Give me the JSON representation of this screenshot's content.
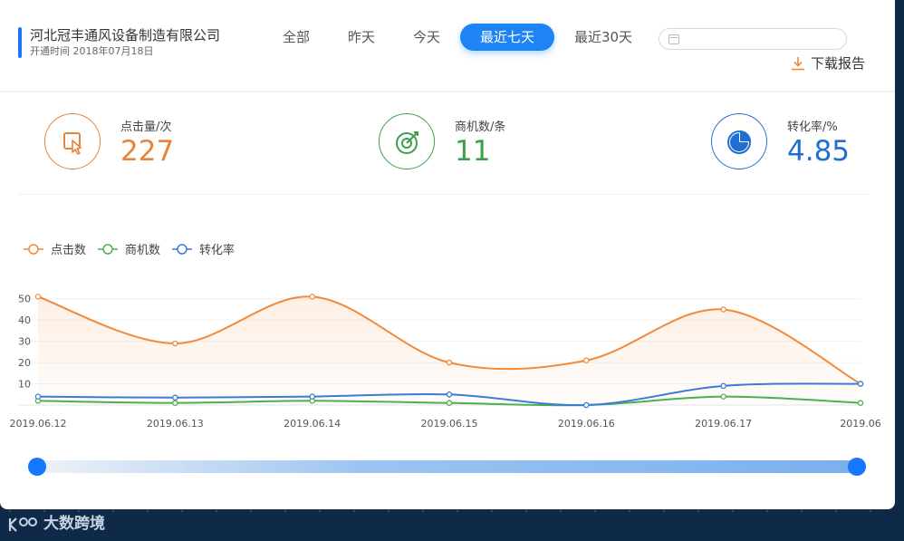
{
  "company": {
    "name": "河北冠丰通风设备制造有限公司",
    "open_date": "开通时间 2018年07月18日"
  },
  "tabs": [
    {
      "label": "全部",
      "active": false
    },
    {
      "label": "昨天",
      "active": false
    },
    {
      "label": "今天",
      "active": false
    },
    {
      "label": "最近七天",
      "active": true
    },
    {
      "label": "最近30天",
      "active": false
    }
  ],
  "date_input": {
    "value": ""
  },
  "download": {
    "label": "下载报告",
    "icon": "download-icon",
    "color": "#f08a3c"
  },
  "stats": [
    {
      "label": "点击量/次",
      "value": "227",
      "icon": "click-cursor-icon",
      "color": "#e8833a"
    },
    {
      "label": "商机数/条",
      "value": "11",
      "icon": "target-icon",
      "color": "#3aa14a"
    },
    {
      "label": "转化率/%",
      "value": "4.85",
      "icon": "pie-icon",
      "color": "#1f6fd1"
    }
  ],
  "chart_data": {
    "type": "line",
    "categories": [
      "2019.06.12",
      "2019.06.13",
      "2019.06.14",
      "2019.06.15",
      "2019.06.16",
      "2019.06.17",
      "2019.06"
    ],
    "yticks": [
      "10",
      "20",
      "30",
      "40",
      "50"
    ],
    "ylim": [
      0,
      55
    ],
    "legend_position": "top-left",
    "smooth": true,
    "series": [
      {
        "name": "点击数",
        "color": "#f08a3c",
        "area": true,
        "values": [
          51,
          29,
          51,
          20,
          21,
          45,
          10
        ]
      },
      {
        "name": "商机数",
        "color": "#4caf50",
        "area": false,
        "values": [
          2,
          1,
          2,
          1,
          0,
          4,
          1
        ]
      },
      {
        "name": "转化率",
        "color": "#3a7bd5",
        "area": false,
        "values": [
          4,
          3.5,
          4,
          5,
          0,
          9,
          10
        ]
      }
    ],
    "grid": true
  },
  "slider": {
    "start": 0,
    "end": 1
  },
  "watermark": {
    "text": "大数跨境"
  }
}
